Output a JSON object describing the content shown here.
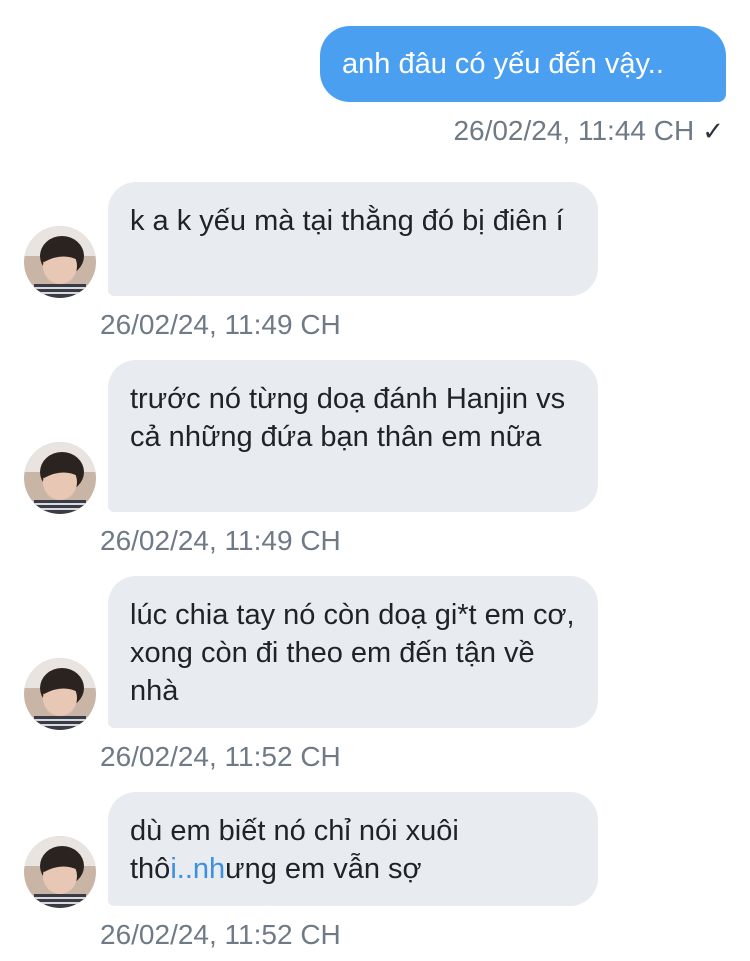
{
  "sent": {
    "text": "anh đâu có yếu đến vậy..",
    "time": "26/02/24, 11:44 CH",
    "read_mark": "✓"
  },
  "received": [
    {
      "text": "k a k yếu mà tại thằng đó bị điên í",
      "time": "26/02/24, 11:49 CH"
    },
    {
      "text": "trước nó từng doạ đánh Hanjin vs cả những đứa bạn thân em nữa",
      "time": "26/02/24, 11:49 CH"
    },
    {
      "text": "lúc chia tay nó còn doạ gi*t em cơ, xong còn đi theo em đến tận về nhà",
      "time": "26/02/24, 11:52 CH"
    },
    {
      "text_before": "dù em biết nó chỉ nói xuôi thô",
      "text_link": "i..nh",
      "text_after": "ưng em vẫn sợ",
      "time": "26/02/24, 11:52 CH"
    }
  ],
  "colors": {
    "sent_bubble": "#4a9ff0",
    "received_bubble": "#e8ebef",
    "timestamp": "#6f7a87",
    "link": "#3d8fe0"
  },
  "icons": {
    "avatar": "contact-avatar-photo",
    "read": "checkmark-icon"
  }
}
